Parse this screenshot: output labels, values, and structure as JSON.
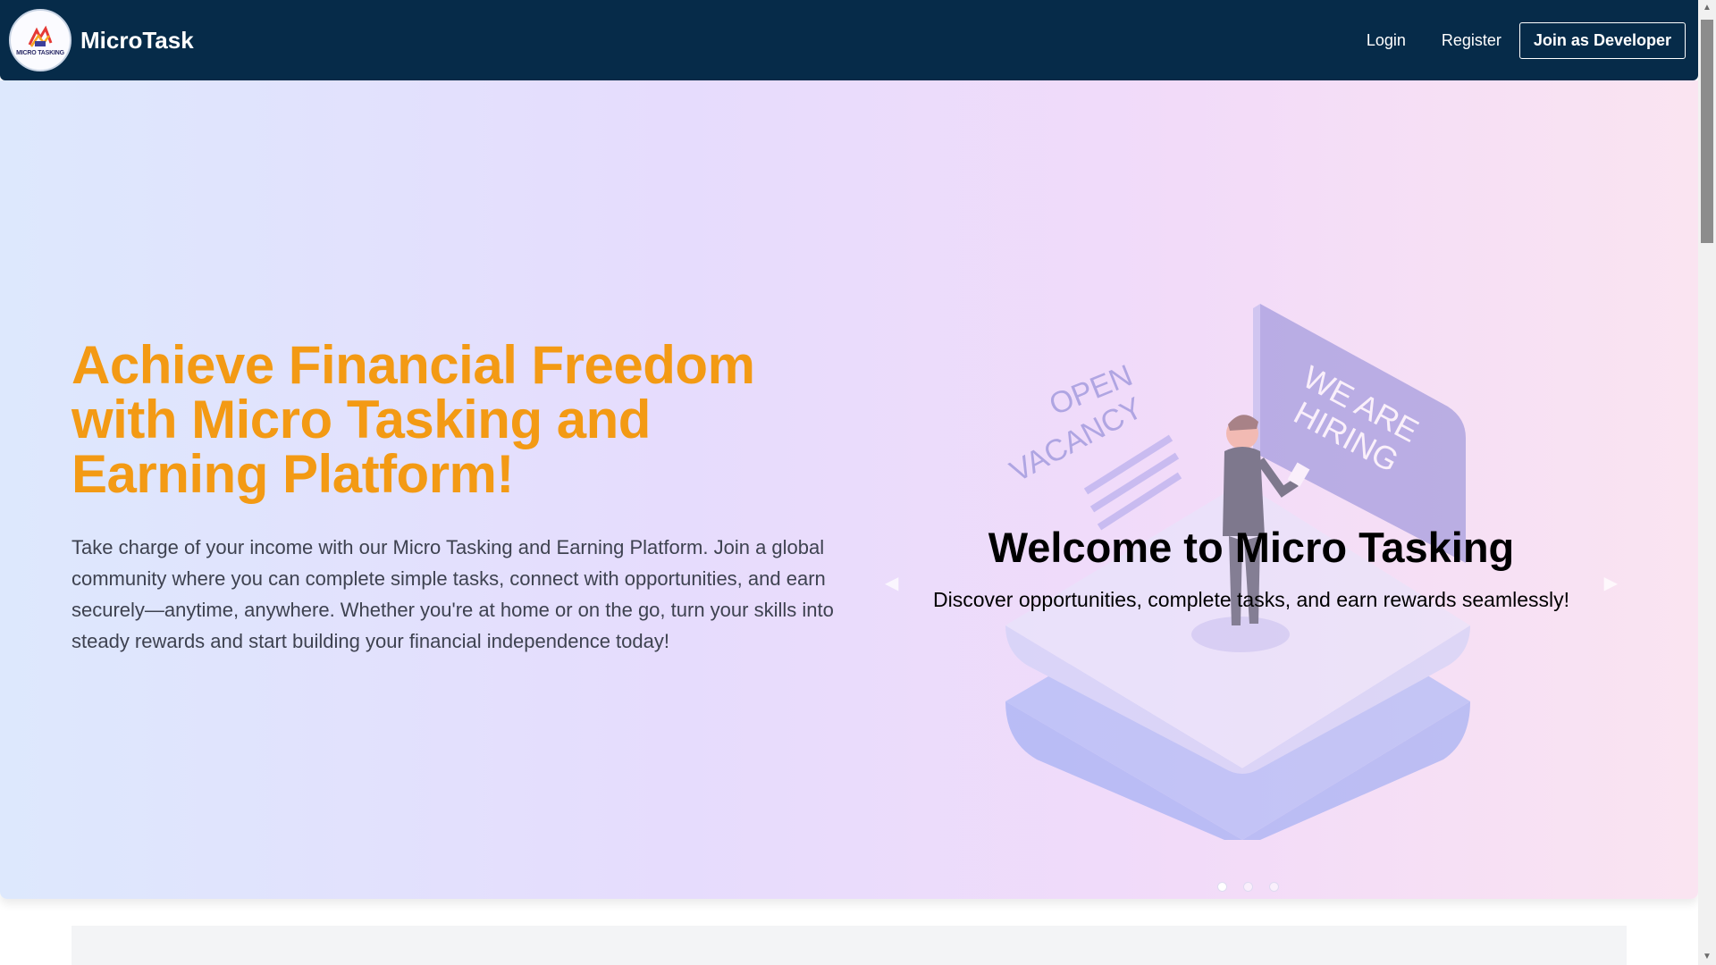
{
  "navbar": {
    "logo_text": "MICRO TASKING",
    "brand": "MicroTask",
    "links": [
      {
        "label": "Login"
      },
      {
        "label": "Register"
      }
    ],
    "cta": "Join as Developer"
  },
  "hero": {
    "title": "Achieve Financial Freedom with Micro Tasking and Earning Platform!",
    "description": "Take charge of your income with our Micro Tasking and Earning Platform. Join a global community where you can complete simple tasks, connect with opportunities, and earn securely—anytime, anywhere. Whether you're at home or on the go, turn your skills into steady rewards and start building your financial independence today!"
  },
  "carousel": {
    "slide_title": "Welcome to Micro Tasking",
    "slide_subtitle": "Discover opportunities, complete tasks, and earn rewards seamlessly!",
    "illustration_texts": {
      "sign_left_1": "OPEN",
      "sign_left_2": "VACANCY",
      "board_1": "WE ARE",
      "board_2": "HIRING"
    },
    "prev_icon": "chevron-left-icon",
    "next_icon": "chevron-right-icon",
    "active_slide": 1,
    "slide_count": 3
  },
  "colors": {
    "navbar": "#062b49",
    "hero_title": "#f39a14",
    "hero_text": "#3e4250"
  }
}
